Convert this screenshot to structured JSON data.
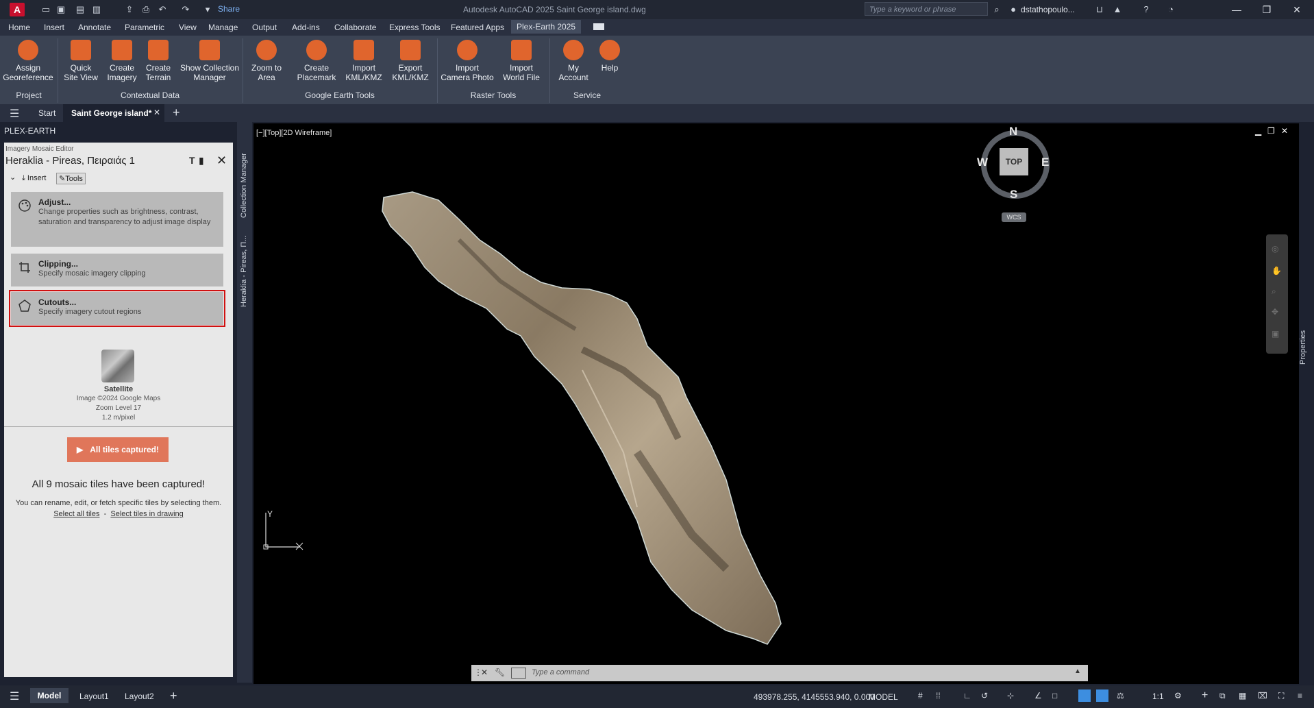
{
  "app": {
    "title": "Autodesk AutoCAD 2025   Saint George island.dwg",
    "share_label": "Share",
    "search_placeholder": "Type a keyword or phrase",
    "user": "dstathopoulo..."
  },
  "ribbon_tabs": [
    "Home",
    "Insert",
    "Annotate",
    "Parametric",
    "View",
    "Manage",
    "Output",
    "Add-ins",
    "Collaborate",
    "Express Tools",
    "Featured Apps",
    "Plex-Earth 2025"
  ],
  "ribbon": {
    "buttons": [
      {
        "l1": "Assign",
        "l2": "Georeference"
      },
      {
        "l1": "Quick",
        "l2": "Site View"
      },
      {
        "l1": "Create",
        "l2": "Imagery"
      },
      {
        "l1": "Create",
        "l2": "Terrain"
      },
      {
        "l1": "Show Collection",
        "l2": "Manager"
      },
      {
        "l1": "Zoom to",
        "l2": "Area"
      },
      {
        "l1": "Create",
        "l2": "Placemark"
      },
      {
        "l1": "Import",
        "l2": "KML/KMZ"
      },
      {
        "l1": "Export",
        "l2": "KML/KMZ"
      },
      {
        "l1": "Import",
        "l2": "Camera Photo"
      },
      {
        "l1": "Import",
        "l2": "World File"
      },
      {
        "l1": "My",
        "l2": "Account"
      },
      {
        "l1": "Help",
        "l2": ""
      }
    ],
    "groups": [
      "Project",
      "Contextual Data",
      "Google Earth Tools",
      "Raster Tools",
      "Service"
    ]
  },
  "file_tabs": {
    "start": "Start",
    "file": "Saint George island*"
  },
  "panel": {
    "header": "PLEX-EARTH",
    "editor_label": "Imagery Mosaic Editor",
    "mosaic_name": "Heraklia - Pireas, Πειραιάς 1",
    "insert_tab": "Insert",
    "tools_tab": "Tools",
    "cards": [
      {
        "title": "Adjust...",
        "desc": "Change properties such as brightness, contrast, saturation and transparency to adjust image display"
      },
      {
        "title": "Clipping...",
        "desc": "Specify mosaic imagery clipping"
      },
      {
        "title": "Cutouts...",
        "desc": "Specify imagery cutout regions"
      }
    ],
    "source": {
      "name": "Satellite",
      "copyright": "Image ©2024 Google Maps",
      "zoom": "Zoom Level 17",
      "resolution": "1.2 m/pixel"
    },
    "capture_button": "All tiles captured!",
    "captured_msg": "All 9 mosaic tiles have been captured!",
    "hint": "You can rename, edit, or fetch specific tiles by selecting them.",
    "select_all": "Select all tiles",
    "separator": "-",
    "select_in_drawing": "Select tiles in drawing",
    "vertical_tabs": [
      "Collection Manager",
      "Heraklia - Pireas, П..."
    ]
  },
  "viewport": {
    "label": "[−][Top][2D Wireframe]",
    "compass": {
      "n": "N",
      "s": "S",
      "e": "E",
      "w": "W",
      "top": "TOP",
      "wcs": "WCS"
    },
    "properties_tab": "Properties",
    "ucs_y": "Y",
    "command_placeholder": "Type a command"
  },
  "status": {
    "layout_tabs": [
      "Model",
      "Layout1",
      "Layout2"
    ],
    "coords": "493978.255, 4145553.940, 0.000",
    "model": "MODEL",
    "scale": "1:1"
  }
}
